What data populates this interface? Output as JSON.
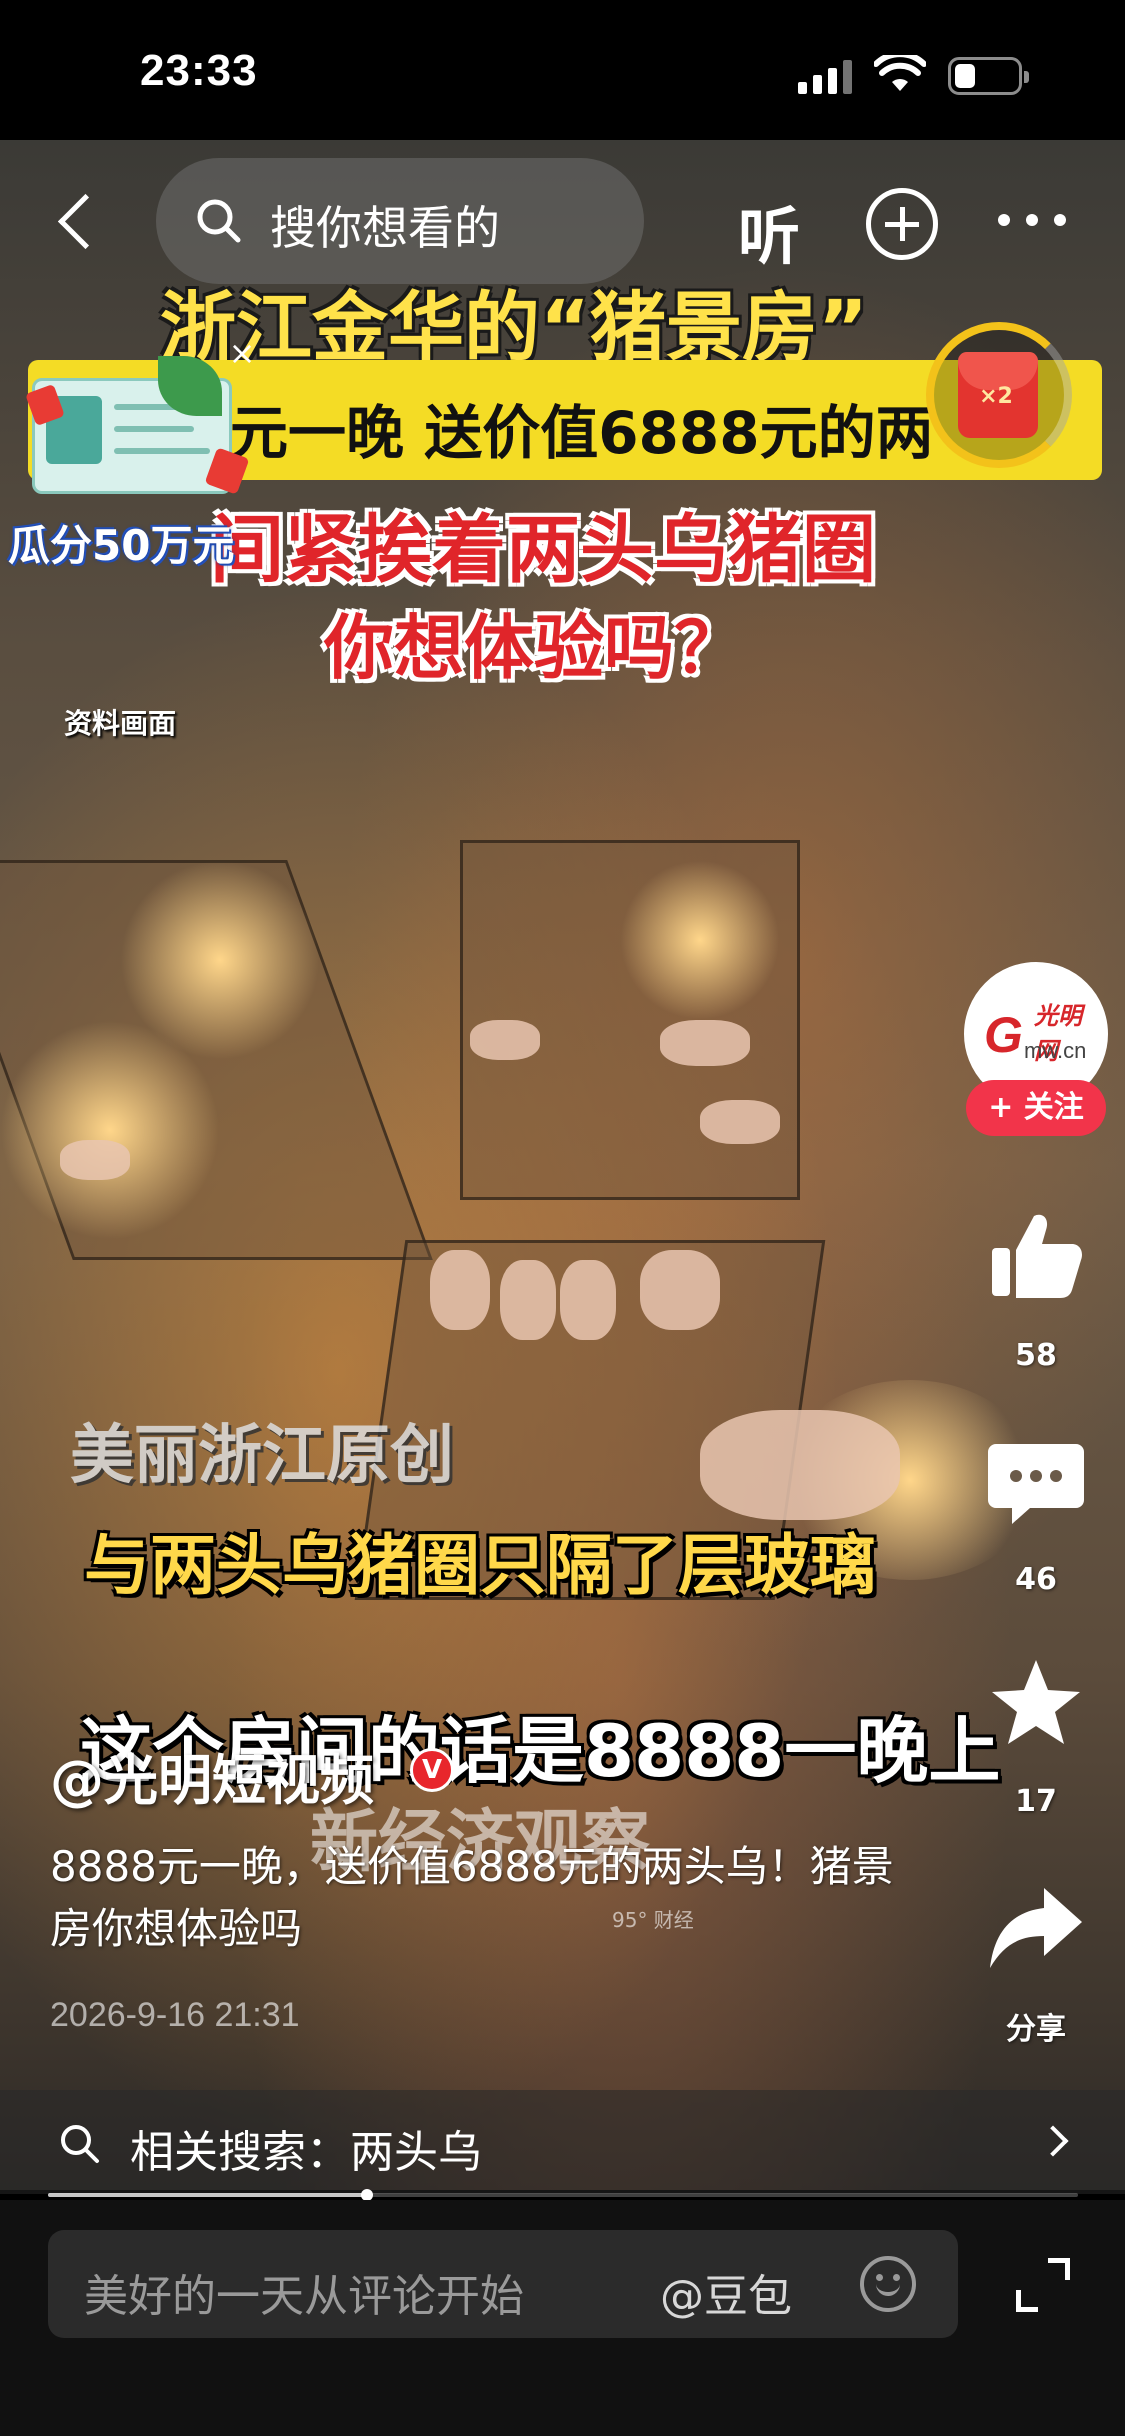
{
  "status_bar": {
    "time": "23:33"
  },
  "top_nav": {
    "search_placeholder": "搜你想看的",
    "listen_label": "听"
  },
  "video_captions": {
    "title": "浙江金华的“猪景房”",
    "band": "元一晚 送价值6888元的两",
    "red_line1": "间紧挨着两头乌猪圈",
    "red_line2": "你想体验吗？",
    "archive_label": "资料画面",
    "original_label": "美丽浙江原创",
    "glass_line": "与两头乌猪圈只隔了层玻璃",
    "price_line": "这个房间的话是8888一晚上",
    "program": "新经济观察",
    "watermark": "95° 财经"
  },
  "promo": {
    "label": "瓜分50万元",
    "close": "×"
  },
  "reward": {
    "multiplier": "×2"
  },
  "author": {
    "avatar_g": "G",
    "avatar_cn": "光明网",
    "avatar_domain": "mw.cn",
    "follow_label": "+ 关注",
    "name": "@光明短视频",
    "verified_mark": "V"
  },
  "actions": {
    "likes": "58",
    "comments": "46",
    "favorites": "17",
    "share_label": "分享"
  },
  "description": {
    "text": "8888元一晚，送价值6888元的两头乌！猪景房你想体验吗",
    "date": "2026-9-16 21:31"
  },
  "related_search": {
    "text": "相关搜索：两头乌"
  },
  "playback": {
    "progress": 0.31
  },
  "comment_bar": {
    "placeholder": "美好的一天从评论开始",
    "mention": "@豆包"
  }
}
